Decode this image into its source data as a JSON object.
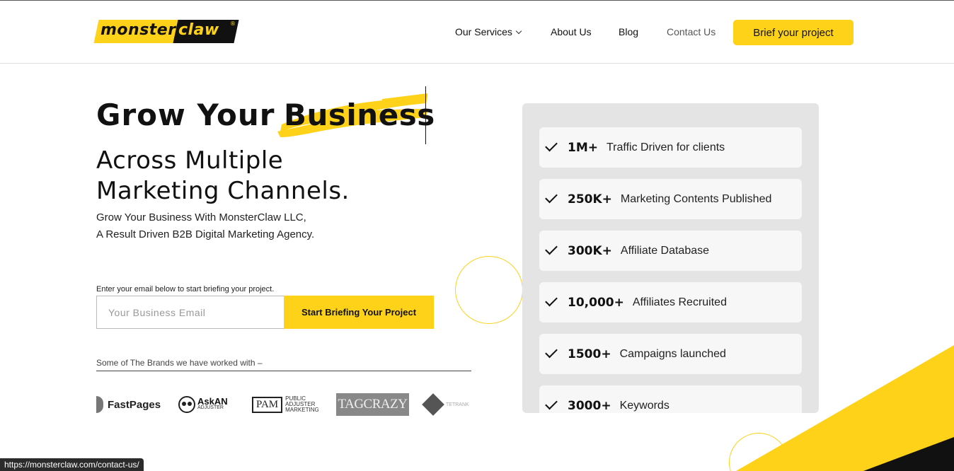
{
  "header": {
    "logo_text_left": "monster",
    "logo_text_right": "claw",
    "logo_reg": "®",
    "nav": {
      "services": "Our Services",
      "about": "About Us",
      "blog": "Blog",
      "contact": "Contact Us"
    },
    "cta": "Brief your project"
  },
  "hero": {
    "title_lead": "Grow Your",
    "title_accent": "Business",
    "subtitle_line1": "Across Multiple",
    "subtitle_line2": "Marketing Channels.",
    "desc_line1": "Grow Your Business With MonsterClaw LLC,",
    "desc_line2": "A Result Driven B2B Digital Marketing Agency.",
    "email_hint": "Enter your email below to start briefing your project.",
    "email_placeholder": "Your Business Email",
    "submit_label": "Start Briefing Your Project",
    "brands_label": "Some of The Brands we have worked with –"
  },
  "brands": {
    "fastpages": "FastPages",
    "askan_main": "AskAN",
    "askan_sub": "ADJUSTER",
    "pam_box": "PAM",
    "pam_l1": "PUBLIC",
    "pam_l2": "ADJUSTER",
    "pam_l3": "MARKETING",
    "tagcrazy": "TAGCRAZY",
    "tetrank": "TETRANK"
  },
  "stats": [
    {
      "num": "1M+",
      "label": "Traffic Driven for clients"
    },
    {
      "num": "250K+",
      "label": "Marketing Contents Published"
    },
    {
      "num": "300K+",
      "label": "Affiliate Database"
    },
    {
      "num": "10,000+",
      "label": "Affiliates Recruited"
    },
    {
      "num": "1500+",
      "label": "Campaigns launched"
    },
    {
      "num": "3000+",
      "label": "Keywords"
    }
  ],
  "status_bar": {
    "url": "https://monsterclaw.com/contact-us/"
  },
  "colors": {
    "brand_yellow": "#ffd21a",
    "dark": "#111111"
  }
}
